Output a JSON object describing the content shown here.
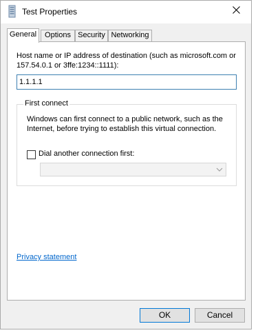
{
  "window": {
    "title": "Test Properties",
    "title_icon": "phone-icon",
    "close_icon": "close-icon"
  },
  "tabs": [
    {
      "label": "General",
      "active": true
    },
    {
      "label": "Options",
      "active": false
    },
    {
      "label": "Security",
      "active": false
    },
    {
      "label": "Networking",
      "active": false
    }
  ],
  "general": {
    "host_label": "Host name or IP address of destination (such as microsoft.com or 157.54.0.1 or 3ffe:1234::1111):",
    "host_value": "1.1.1.1",
    "first_connect": {
      "group_label": "First connect",
      "description": "Windows can first connect to a public network, such as the Internet, before trying to establish this virtual connection.",
      "dial_checkbox_label": "Dial another connection first:",
      "dial_checked": false,
      "dropdown_value": ""
    },
    "privacy_link": "Privacy statement"
  },
  "buttons": {
    "ok": "OK",
    "cancel": "Cancel"
  },
  "colors": {
    "accent": "#0078d7",
    "link": "#0066cc"
  }
}
